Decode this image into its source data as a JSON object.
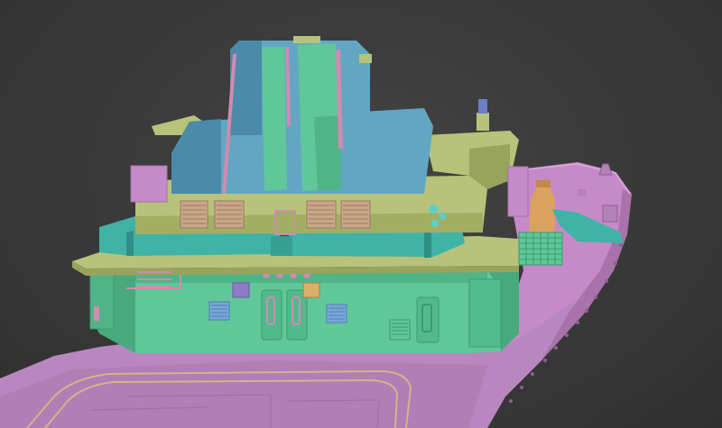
{
  "scene": {
    "subject": "ship-superstructure-3d-model",
    "background_color": "#3b3b3b",
    "colors": {
      "hull": "#c58ac7",
      "hull_shadow": "#a873ab",
      "deck": "#b987bf",
      "lower_structure": "#5fc799",
      "lower_shadow": "#48a97e",
      "teal_band": "#3fb3a6",
      "olive_platform": "#b7c27a",
      "olive_shadow": "#98a35d",
      "tower": "#63a6c4",
      "tower_shadow": "#4b8aa8",
      "accent_pink": "#d08bb0",
      "accent_orange": "#d9a25e",
      "vents": "#c9a68a",
      "mast_blue": "#6a7ec9"
    }
  }
}
